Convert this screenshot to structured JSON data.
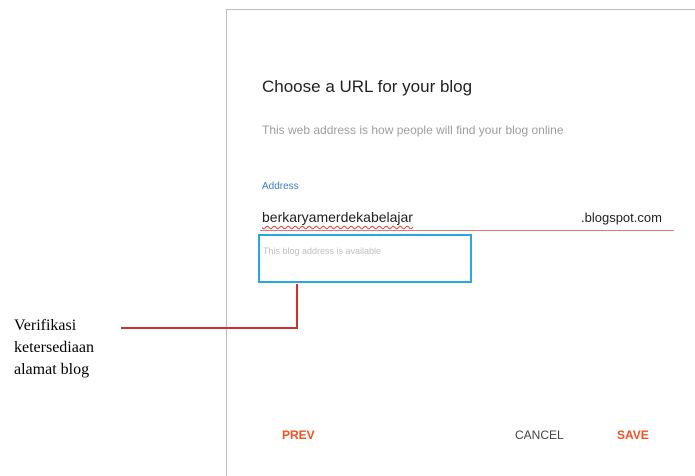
{
  "dialog": {
    "title": "Choose a URL for your blog",
    "subtitle": "This web address is how people will find your blog online",
    "address": {
      "label": "Address",
      "value": "berkaryamerdekabelajar",
      "suffix": ".blogspot.com",
      "availability_message": "This blog address is available"
    },
    "buttons": {
      "prev": "PREV",
      "cancel": "CANCEL",
      "save": "SAVE"
    }
  },
  "annotation": {
    "line1": "Verifikasi",
    "line2": "ketersediaan",
    "line3": "alamat blog"
  },
  "colors": {
    "accent": "#f4511e",
    "highlight_box": "#29a8e0",
    "connector": "#d32f2f",
    "label_blue": "#3a7bd5"
  }
}
